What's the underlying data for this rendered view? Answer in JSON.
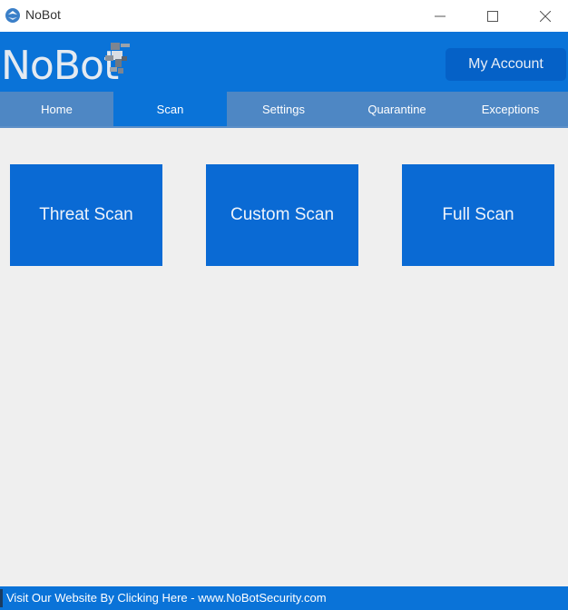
{
  "window": {
    "title": "NoBot",
    "icons": [
      "app-icon",
      "minimize-icon",
      "maximize-icon",
      "close-icon"
    ]
  },
  "header": {
    "logo_text": "NoBot",
    "logo_icon": "bot-mascot-icon",
    "account_label": "My Account"
  },
  "tabs": [
    {
      "label": "Home",
      "active": false
    },
    {
      "label": "Scan",
      "active": true
    },
    {
      "label": "Settings",
      "active": false
    },
    {
      "label": "Quarantine",
      "active": false
    },
    {
      "label": "Exceptions",
      "active": false
    }
  ],
  "scan_options": [
    {
      "label": "Threat Scan"
    },
    {
      "label": "Custom Scan"
    },
    {
      "label": "Full Scan"
    }
  ],
  "footer": {
    "link_text": "Visit Our Website By Clicking Here - www.NoBotSecurity.com"
  },
  "colors": {
    "brand": "#0a73d8",
    "tab_bar": "#4e87c4",
    "tile": "#0a6ad4",
    "account_button": "#0561c7",
    "background": "#efefef"
  }
}
